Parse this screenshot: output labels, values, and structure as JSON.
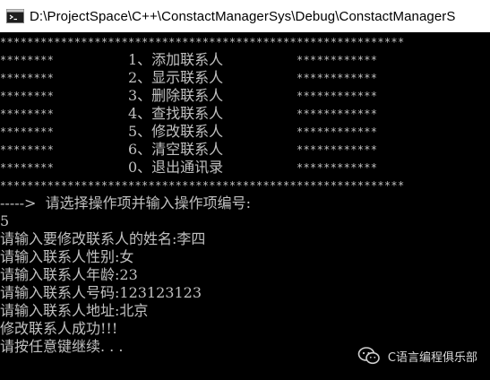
{
  "window": {
    "title": "D:\\ProjectSpace\\C++\\ConstactManagerSys\\Debug\\ConstactManagerS"
  },
  "console": {
    "border_line": "************************************************************",
    "menu": [
      {
        "left": "********",
        "label": "1、添加联系人",
        "right": "************"
      },
      {
        "left": "********",
        "label": "2、显示联系人",
        "right": "************"
      },
      {
        "left": "********",
        "label": "3、删除联系人",
        "right": "************"
      },
      {
        "left": "********",
        "label": "4、查找联系人",
        "right": "************"
      },
      {
        "left": "********",
        "label": "5、修改联系人",
        "right": "************"
      },
      {
        "left": "********",
        "label": "6、清空联系人",
        "right": "************"
      },
      {
        "left": "********",
        "label": "0、退出通讯录",
        "right": "************"
      }
    ],
    "prompt": "----->  请选择操作项并输入操作项编号:",
    "input_choice": "5",
    "output_lines": [
      "请输入要修改联系人的姓名:李四",
      "请输入联系人性别:女",
      "请输入联系人年龄:23",
      "请输入联系人号码:123123123",
      "请输入联系人地址:北京",
      "修改联系人成功!!!",
      "请按任意键继续. . ."
    ]
  },
  "watermark": {
    "text": "C语言编程俱乐部",
    "icon": "wechat-icon"
  }
}
